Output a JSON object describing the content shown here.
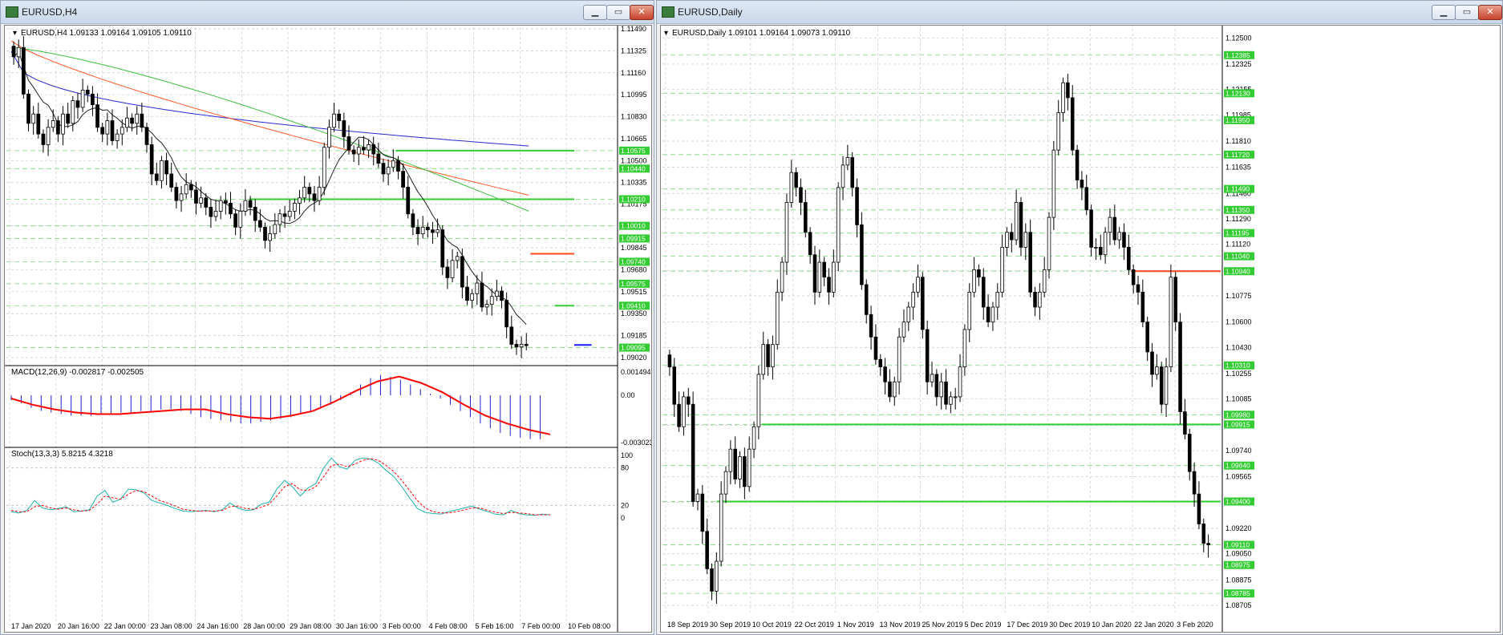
{
  "left_window": {
    "title": "EURUSD,H4",
    "buttons": {
      "minimize": "▁",
      "maximize": "▭",
      "close": "✕"
    },
    "main_header": "EURUSD,H4  1.09133 1.09164 1.09105 1.09110",
    "macd_header": "MACD(12,26,9) -0.002817 -0.002505",
    "stoch_header": "Stoch(13,3,3) 5.8215 4.3218"
  },
  "right_window": {
    "title": "EURUSD,Daily",
    "buttons": {
      "minimize": "▁",
      "maximize": "▭",
      "close": "✕"
    },
    "main_header": "EURUSD,Daily  1.09101 1.09164 1.09073 1.09110"
  },
  "colors": {
    "bull": "#ffffff",
    "bear": "#000000",
    "ma_blue": "#2a2ad0",
    "ma_red": "#ff5a2a",
    "ma_green": "#3fbf3f",
    "ma_black": "#202020",
    "level_green": "#33cc33",
    "level_red": "#ff4a1a",
    "level_blue": "#1a1aff",
    "grid": "#c8c8c8",
    "macd_hist": "#2020c8",
    "macd_signal": "#ff0000",
    "stoch_main": "#20b2aa",
    "stoch_signal": "#ff0000"
  },
  "chart_data": [
    {
      "type": "candlestick",
      "title": "EURUSD,H4",
      "ylim": [
        1.0902,
        1.1149
      ],
      "price_ticks": [
        "1.11490",
        "1.11325",
        "1.11160",
        "1.10995",
        "1.10830",
        "1.10665",
        "1.10500",
        "1.10335",
        "1.10175",
        "1.10010",
        "1.09845",
        "1.09680",
        "1.09515",
        "1.09350",
        "1.09185",
        "1.09020"
      ],
      "level_labels": [
        "1.10575",
        "1.10440",
        "1.10210",
        "1.10010",
        "1.09915",
        "1.09740",
        "1.09575",
        "1.09410",
        "1.09095"
      ],
      "x_labels": [
        "17 Jan 2020",
        "20 Jan 16:00",
        "22 Jan 00:00",
        "23 Jan 08:00",
        "24 Jan 16:00",
        "28 Jan 00:00",
        "29 Jan 08:00",
        "30 Jan 16:00",
        "3 Feb 00:00",
        "4 Feb 08:00",
        "5 Feb 16:00",
        "7 Feb 00:00",
        "10 Feb 08:00"
      ],
      "levels": [
        {
          "price": 1.10575,
          "color": "green",
          "from": 0.64
        },
        {
          "price": 1.1021,
          "color": "green",
          "from": 0.4
        },
        {
          "price": 1.098,
          "color": "red",
          "from": 0.86
        },
        {
          "price": 1.0941,
          "color": "green",
          "from": 0.9
        },
        {
          "price": 1.09115,
          "color": "blue",
          "from": 0.96
        }
      ],
      "closes": [
        1.1128,
        1.1135,
        1.11,
        1.1078,
        1.1085,
        1.107,
        1.1062,
        1.1075,
        1.108,
        1.107,
        1.1085,
        1.1078,
        1.1095,
        1.109,
        1.1103,
        1.11,
        1.1092,
        1.1075,
        1.107,
        1.108,
        1.1065,
        1.107,
        1.1075,
        1.1082,
        1.1078,
        1.1085,
        1.1075,
        1.1062,
        1.104,
        1.1035,
        1.105,
        1.104,
        1.103,
        1.102,
        1.1025,
        1.1032,
        1.1028,
        1.1018,
        1.1022,
        1.1015,
        1.1008,
        1.1012,
        1.102,
        1.1018,
        1.101,
        1.1,
        1.1012,
        1.102,
        1.1015,
        1.1005,
        1.1,
        1.099,
        1.0995,
        1.1002,
        1.101,
        1.1008,
        1.1012,
        1.1018,
        1.1022,
        1.103,
        1.1025,
        1.102,
        1.103,
        1.106,
        1.1075,
        1.1085,
        1.108,
        1.1068,
        1.1058,
        1.1055,
        1.106,
        1.1058,
        1.1062,
        1.1055,
        1.1048,
        1.104,
        1.1045,
        1.105,
        1.1042,
        1.103,
        1.101,
        1.1,
        1.0995,
        1.1,
        1.0998,
        1.0996,
        1.0998,
        1.097,
        1.0962,
        1.0975,
        1.0978,
        1.0955,
        1.0945,
        1.095,
        1.0958,
        1.094,
        1.0942,
        1.0948,
        1.0952,
        1.0945,
        1.0925,
        1.0912,
        1.091,
        1.0912,
        1.0911
      ],
      "ma_slow": {
        "start": 1.1132,
        "end": 1.1061
      },
      "ma_mid": {
        "start": 1.114,
        "end": 1.1024
      },
      "ma_fast": {
        "start": 1.1135,
        "end": 1.1012
      }
    },
    {
      "type": "bar",
      "title": "MACD(12,26,9)",
      "ylim": [
        -0.003023,
        0.001494
      ],
      "y_ticks": [
        "0.001494",
        "0.00",
        "-0.003023"
      ],
      "histogram": [
        -0.0003,
        -0.0005,
        -0.0008,
        -0.001,
        -0.0011,
        -0.0012,
        -0.0013,
        -0.0013,
        -0.0013,
        -0.0012,
        -0.0012,
        -0.0011,
        -0.0011,
        -0.001,
        -0.001,
        -0.0009,
        -0.0009,
        -0.001,
        -0.0012,
        -0.0014,
        -0.0015,
        -0.0016,
        -0.0017,
        -0.0018,
        -0.0018,
        -0.0017,
        -0.0016,
        -0.0015,
        -0.0014,
        -0.0012,
        -0.001,
        -0.0008,
        -0.0006,
        -0.0003,
        0.0002,
        0.0007,
        0.0011,
        0.0013,
        0.0012,
        0.001,
        0.0007,
        0.0004,
        0.0001,
        -0.0002,
        -0.0006,
        -0.001,
        -0.0014,
        -0.0018,
        -0.0021,
        -0.0024,
        -0.0026,
        -0.0027,
        -0.0028,
        -0.0028
      ],
      "signal": {
        "name": "Signal",
        "values": [
          -0.0002,
          -0.0006,
          -0.0009,
          -0.0011,
          -0.0012,
          -0.0012,
          -0.0011,
          -0.001,
          -0.0009,
          -0.0009,
          -0.0012,
          -0.0014,
          -0.0015,
          -0.0013,
          -0.001,
          -0.0004,
          0.0003,
          0.0009,
          0.0012,
          0.0008,
          0.0002,
          -0.0006,
          -0.0013,
          -0.0018,
          -0.0022,
          -0.0025
        ]
      }
    },
    {
      "type": "line",
      "title": "Stoch(13,3,3)",
      "ylim": [
        0,
        100
      ],
      "y_ticks": [
        "100",
        "80",
        "20",
        "0"
      ],
      "series": [
        {
          "name": "main",
          "values": [
            10,
            8,
            12,
            28,
            16,
            13,
            15,
            18,
            10,
            11,
            13,
            35,
            44,
            25,
            30,
            46,
            45,
            40,
            28,
            24,
            20,
            15,
            11,
            10,
            11,
            12,
            10,
            13,
            24,
            16,
            12,
            13,
            22,
            25,
            46,
            60,
            50,
            35,
            48,
            55,
            80,
            96,
            82,
            78,
            92,
            96,
            94,
            88,
            76,
            66,
            50,
            32,
            15,
            9,
            7,
            6,
            10,
            13,
            16,
            19,
            14,
            10,
            6,
            5,
            12,
            7,
            5,
            4,
            6,
            5
          ]
        },
        {
          "name": "signal",
          "values": [
            12,
            10,
            10,
            18,
            20,
            16,
            14,
            16,
            13,
            11,
            12,
            22,
            35,
            32,
            30,
            38,
            44,
            42,
            35,
            28,
            24,
            19,
            14,
            12,
            11,
            11,
            11,
            12,
            18,
            19,
            15,
            14,
            17,
            22,
            35,
            50,
            55,
            45,
            44,
            50,
            66,
            84,
            86,
            82,
            86,
            92,
            95,
            92,
            84,
            74,
            60,
            44,
            28,
            16,
            10,
            8,
            8,
            10,
            13,
            16,
            16,
            12,
            9,
            7,
            9,
            8,
            7,
            5,
            5,
            5
          ]
        }
      ]
    },
    {
      "type": "candlestick",
      "title": "EURUSD,Daily",
      "ylim": [
        1.087,
        1.1255
      ],
      "price_ticks": [
        "1.12500",
        "1.12325",
        "1.12155",
        "1.11985",
        "1.11810",
        "1.11635",
        "1.11460",
        "1.11290",
        "1.11120",
        "1.10945",
        "1.10775",
        "1.10600",
        "1.10430",
        "1.10255",
        "1.10085",
        "1.09910",
        "1.09740",
        "1.09565",
        "1.09395",
        "1.09220",
        "1.09050",
        "1.08875",
        "1.08705"
      ],
      "level_labels": [
        "1.12385",
        "1.12130",
        "1.11950",
        "1.11720",
        "1.11490",
        "1.11350",
        "1.11195",
        "1.11040",
        "1.10940",
        "1.10310",
        "1.09980",
        "1.09915",
        "1.09640",
        "1.09400",
        "1.09110",
        "1.08975",
        "1.08785"
      ],
      "x_labels": [
        "18 Sep 2019",
        "30 Sep 2019",
        "10 Oct 2019",
        "22 Oct 2019",
        "1 Nov 2019",
        "13 Nov 2019",
        "25 Nov 2019",
        "5 Dec 2019",
        "17 Dec 2019",
        "30 Dec 2019",
        "10 Jan 2020",
        "22 Jan 2020",
        "3 Feb 2020"
      ],
      "levels": [
        {
          "price": 1.1094,
          "color": "red",
          "from": 0.84
        },
        {
          "price": 1.09915,
          "color": "green",
          "from": 0.18
        },
        {
          "price": 1.094,
          "color": "green",
          "from": 0.1
        }
      ],
      "closes": [
        1.103,
        1.1005,
        1.099,
        1.101,
        1.1005,
        1.094,
        1.0945,
        1.092,
        1.0895,
        1.088,
        1.09,
        1.0945,
        1.096,
        1.0975,
        1.0955,
        1.097,
        1.095,
        1.0975,
        1.099,
        1.1025,
        1.1045,
        1.103,
        1.1045,
        1.108,
        1.11,
        1.114,
        1.116,
        1.115,
        1.114,
        1.112,
        1.1105,
        1.108,
        1.11,
        1.109,
        1.108,
        1.11,
        1.115,
        1.1165,
        1.117,
        1.115,
        1.1125,
        1.1085,
        1.1065,
        1.105,
        1.1035,
        1.103,
        1.102,
        1.101,
        1.102,
        1.105,
        1.106,
        1.107,
        1.108,
        1.109,
        1.1055,
        1.102,
        1.1025,
        1.101,
        1.102,
        1.1005,
        1.101,
        1.101,
        1.103,
        1.1055,
        1.108,
        1.1095,
        1.109,
        1.107,
        1.106,
        1.107,
        1.108,
        1.111,
        1.112,
        1.1115,
        1.114,
        1.111,
        1.112,
        1.108,
        1.107,
        1.108,
        1.1095,
        1.113,
        1.1175,
        1.12,
        1.122,
        1.121,
        1.1175,
        1.1155,
        1.115,
        1.1135,
        1.111,
        1.111,
        1.1105,
        1.112,
        1.113,
        1.1115,
        1.112,
        1.111,
        1.1095,
        1.1085,
        1.108,
        1.106,
        1.104,
        1.1025,
        1.103,
        1.1005,
        1.103,
        1.109,
        1.106,
        1.1,
        1.0985,
        1.096,
        1.0945,
        1.0925,
        1.0912,
        1.0911
      ]
    }
  ]
}
